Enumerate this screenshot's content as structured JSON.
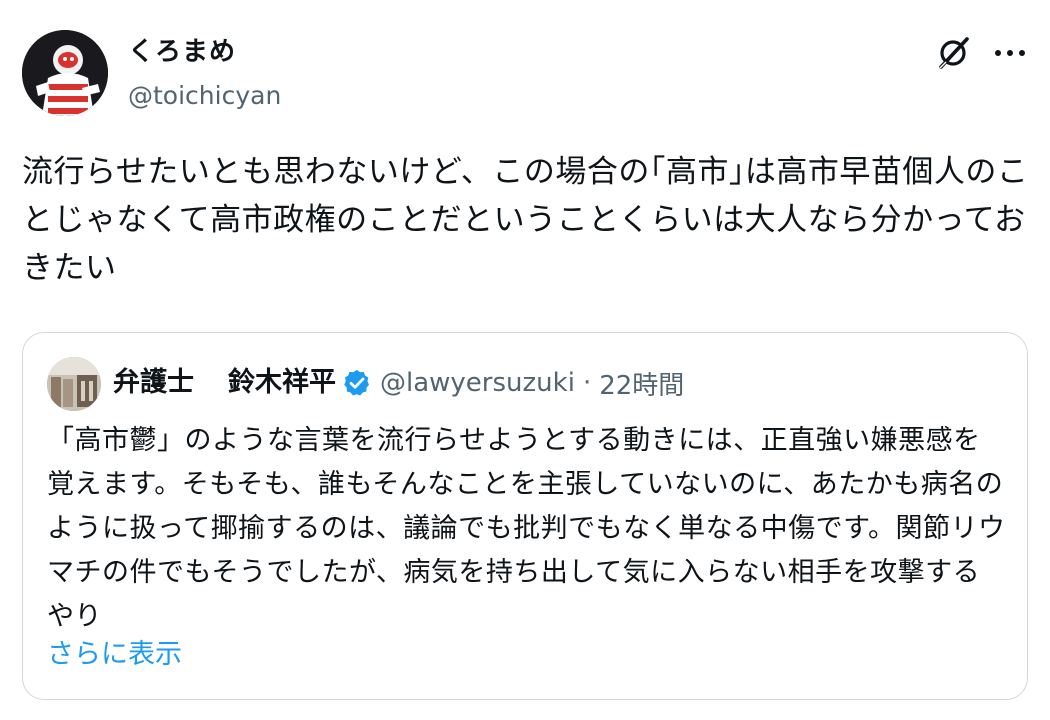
{
  "author": {
    "display_name": "くろまめ",
    "handle": "@toichicyan"
  },
  "tweet": {
    "text": "流行らせたいとも思わないけど、この場合の｢高市｣は高市早苗個人のことじゃなくて高市政権のことだということくらいは大人なら分かっておきたい"
  },
  "quote": {
    "name_part1": "弁護士",
    "name_part2": "鈴木祥平",
    "handle": "@lawyersuzuki",
    "separator": "·",
    "time": "22時間",
    "text": "「高市鬱」のような言葉を流行らせようとする動きには、正直強い嫌悪感を覚えます。そもそも、誰もそんなことを主張していないのに、あたかも病名のように扱って揶揄するのは、議論でも批判でもなく単なる中傷です。関節リウマチの件でもそうでしたが、病気を持ち出して気に入らない相手を攻撃するやり",
    "show_more": "さらに表示"
  },
  "icons": {
    "avatar": "astronaut-avatar",
    "grok": "grok-icon",
    "more": "more-dots-icon",
    "verified": "verified-badge-icon"
  },
  "colors": {
    "link": "#1d9bf0",
    "secondary_text": "#536471",
    "border": "#cfd9de",
    "verified": "#1d9bf0"
  }
}
